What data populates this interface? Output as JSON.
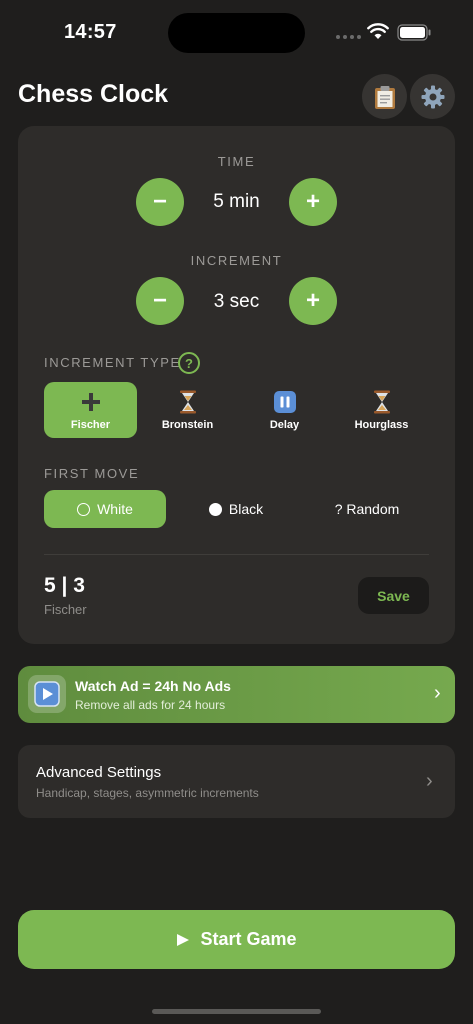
{
  "status_bar": {
    "time": "14:57"
  },
  "header": {
    "title": "Chess Clock"
  },
  "time_setting": {
    "label": "TIME",
    "value": "5 min",
    "minus": "−",
    "plus": "+"
  },
  "increment_setting": {
    "label": "INCREMENT",
    "value": "3 sec",
    "minus": "−",
    "plus": "+"
  },
  "increment_type": {
    "label": "INCREMENT TYPE",
    "help": "?",
    "options": [
      {
        "label": "Fischer",
        "icon": "plus-icon",
        "selected": true
      },
      {
        "label": "Bronstein",
        "icon": "hourglass-icon",
        "selected": false
      },
      {
        "label": "Delay",
        "icon": "pause-icon",
        "selected": false
      },
      {
        "label": "Hourglass",
        "icon": "hourglass-icon",
        "selected": false
      }
    ]
  },
  "first_move": {
    "label": "FIRST MOVE",
    "options": [
      {
        "label": "White",
        "selected": true
      },
      {
        "label": "Black",
        "selected": false
      },
      {
        "label": "? Random",
        "selected": false
      }
    ]
  },
  "summary": {
    "value": "5 | 3",
    "type": "Fischer",
    "save_label": "Save"
  },
  "ad": {
    "title": "Watch Ad = 24h No Ads",
    "subtitle": "Remove all ads for 24 hours",
    "chevron": "›"
  },
  "advanced": {
    "title": "Advanced Settings",
    "subtitle": "Handicap, stages, asymmetric increments",
    "chevron": "›"
  },
  "start": {
    "label": "Start Game"
  },
  "colors": {
    "accent": "#7db852",
    "background": "#1f1e1d",
    "card": "#2e2c2a"
  }
}
